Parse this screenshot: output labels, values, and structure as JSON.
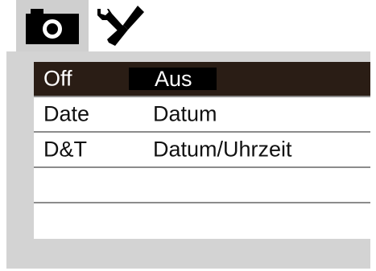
{
  "tabs": [
    {
      "id": "camera",
      "icon": "camera-icon",
      "selected": true
    },
    {
      "id": "tools",
      "icon": "wrench-screwdriver-icon",
      "selected": false
    }
  ],
  "menu": {
    "items": [
      {
        "key": "Off",
        "value": "Aus",
        "selected": true
      },
      {
        "key": "Date",
        "value": "Datum",
        "selected": false
      },
      {
        "key": "D&T",
        "value": "Datum/Uhrzeit",
        "selected": false
      },
      {
        "key": "",
        "value": "",
        "selected": false
      },
      {
        "key": "",
        "value": "",
        "selected": false
      }
    ]
  },
  "colors": {
    "selected_row": "#2a1d15",
    "selected_value_box": "#000000",
    "panel": "#d3d3d3",
    "active_tab": "#cfcfcf",
    "separator": "#8c8c8c"
  }
}
